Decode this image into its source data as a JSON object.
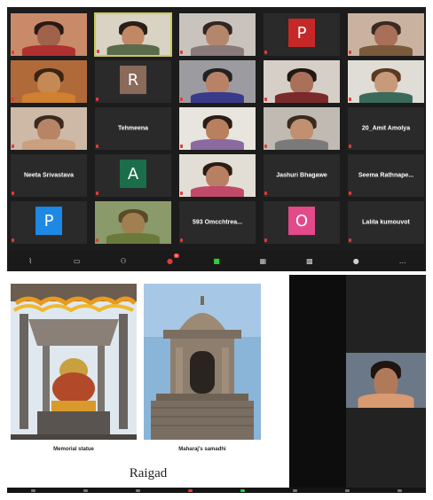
{
  "meeting": {
    "participants": [
      {
        "name": "",
        "kind": "video",
        "bg": "#c98a6a",
        "skin": "#a0624a",
        "hair": "#2a1a14",
        "shirt": "#b03030"
      },
      {
        "name": "",
        "kind": "video",
        "bg": "#d8d3c2",
        "skin": "#c28866",
        "hair": "#2b1e18",
        "shirt": "#5b6b4a",
        "speaking": true
      },
      {
        "name": "",
        "kind": "video",
        "bg": "#c9c3bd",
        "skin": "#b4876c",
        "hair": "#332620",
        "shirt": "#8a7a7a"
      },
      {
        "name": "",
        "kind": "avatar",
        "letter": "P",
        "color": "#c62828"
      },
      {
        "name": "",
        "kind": "video",
        "bg": "#c9b3a0",
        "skin": "#a87058",
        "hair": "#3a2a22",
        "shirt": "#7a5a3a"
      },
      {
        "name": "",
        "kind": "video",
        "bg": "#b06a3a",
        "skin": "#c48a56",
        "hair": "#3a2414",
        "shirt": "#d08030"
      },
      {
        "name": "",
        "kind": "avatar",
        "letter": "R",
        "color": "#8a6a5a"
      },
      {
        "name": "",
        "kind": "video",
        "bg": "#9c9ca0",
        "skin": "#b88266",
        "hair": "#222",
        "shirt": "#3a3a8a"
      },
      {
        "name": "",
        "kind": "video",
        "bg": "#d6cfc8",
        "skin": "#a9705a",
        "hair": "#221812",
        "shirt": "#7a2a2a"
      },
      {
        "name": "",
        "kind": "video",
        "bg": "#e0ddd6",
        "skin": "#c89a7a",
        "hair": "#5a3a22",
        "shirt": "#3a6a5a"
      },
      {
        "name": "",
        "kind": "video",
        "bg": "#cdb9a6",
        "skin": "#b88466",
        "hair": "#3a2a20",
        "shirt": "#c9a080"
      },
      {
        "name": "Tehmeena",
        "kind": "text"
      },
      {
        "name": "",
        "kind": "video",
        "bg": "#e8e4de",
        "skin": "#b8805e",
        "hair": "#2a1c16",
        "shirt": "#8a6aa0"
      },
      {
        "name": "",
        "kind": "video",
        "bg": "#c0bab2",
        "skin": "#c09070",
        "hair": "#3a2a20",
        "shirt": "#7a7a7a"
      },
      {
        "name": "20_Amit Amolya",
        "kind": "text"
      },
      {
        "name": "Neeta Srivastava",
        "kind": "text"
      },
      {
        "name": "",
        "kind": "avatar",
        "letter": "A",
        "color": "#1b6e4a"
      },
      {
        "name": "",
        "kind": "video",
        "bg": "#e2ded6",
        "skin": "#b88062",
        "hair": "#2a1c14",
        "shirt": "#c04a6a"
      },
      {
        "name": "Jashuri Bhagawe",
        "kind": "text"
      },
      {
        "name": "Seema Rathnape...",
        "kind": "text"
      },
      {
        "name": "",
        "kind": "avatar",
        "letter": "P",
        "color": "#1e88e5"
      },
      {
        "name": "",
        "kind": "video",
        "bg": "#8a9a6a",
        "skin": "#a08050",
        "hair": "#5a4a2a",
        "shirt": "#6a7a3a"
      },
      {
        "name": "593 Omcchtrea...",
        "kind": "text"
      },
      {
        "name": "",
        "kind": "avatar",
        "letter": "O",
        "color": "#e24a8a"
      },
      {
        "name": "Lalita kumouvot",
        "kind": "text"
      }
    ]
  },
  "toolbar_top": [
    {
      "icon": "mic-icon",
      "glyph": "⌇"
    },
    {
      "icon": "video-icon",
      "glyph": "▭"
    },
    {
      "icon": "participants-icon",
      "glyph": "⚇"
    },
    {
      "icon": "chat-icon",
      "glyph": "●",
      "badge": "9"
    },
    {
      "icon": "share-screen-icon",
      "glyph": "■",
      "color": "#2ecc40"
    },
    {
      "icon": "gallery-view-icon",
      "glyph": "▦"
    },
    {
      "icon": "grid-icon",
      "glyph": "▩"
    },
    {
      "icon": "reactions-icon",
      "glyph": "●"
    },
    {
      "icon": "more-icon",
      "glyph": "…"
    }
  ],
  "slide": {
    "caption_left": "Memorial statue",
    "caption_right": "Maharaj's samadhi",
    "title": "Raigad"
  },
  "self_view": {
    "name": ""
  }
}
